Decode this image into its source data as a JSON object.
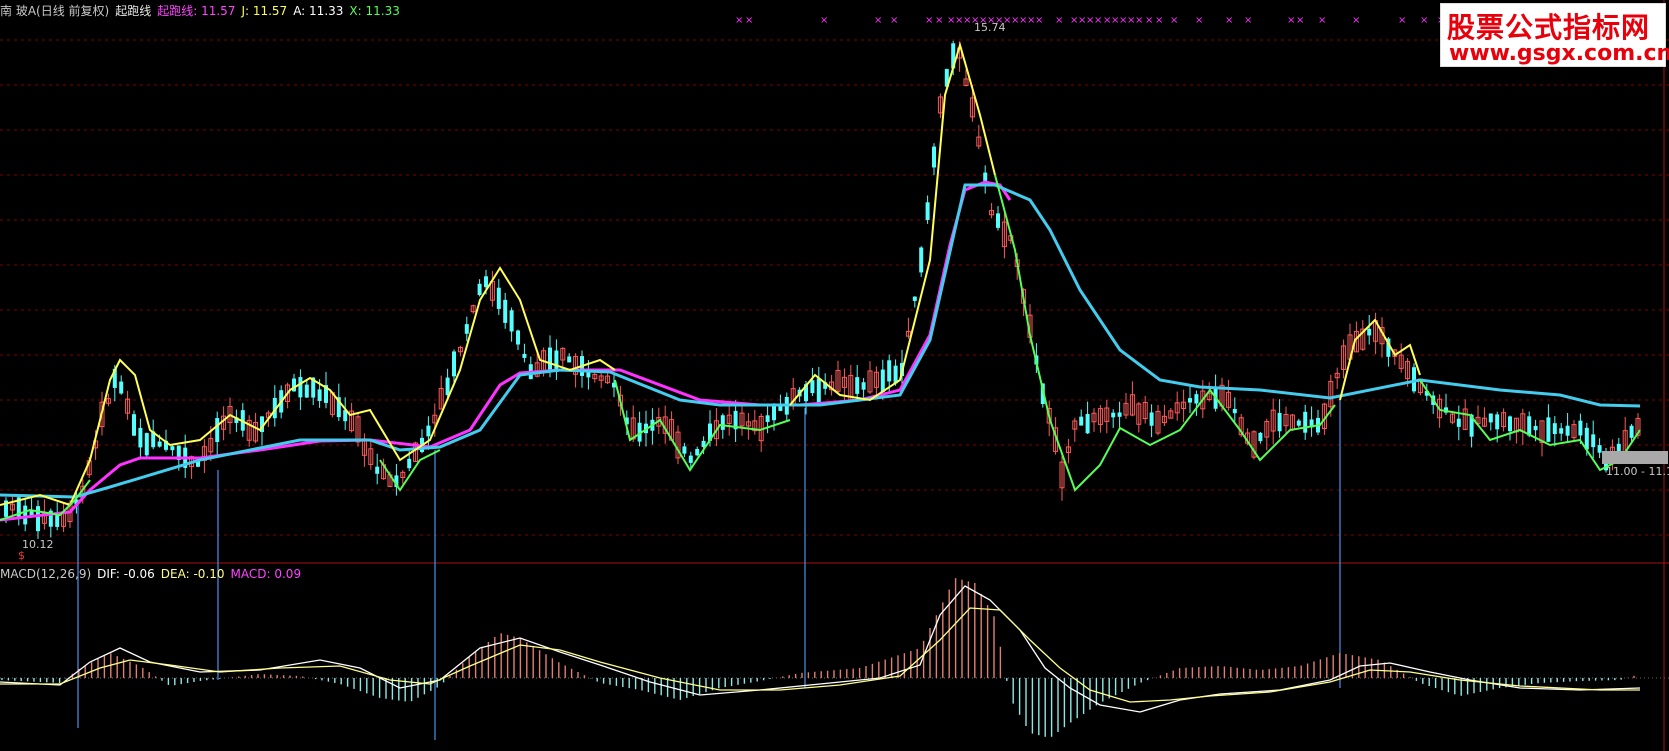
{
  "header": {
    "title": "南 玻A(日线 前复权)",
    "indicator_name": "起跑线",
    "indicator_value": "起跑线: 11.57",
    "j_value": "J: 11.57",
    "a_value": "A: 11.33",
    "x_value": "X: 11.33"
  },
  "macd_header": {
    "name": "MACD(12,26,9)",
    "dif": "DIF: -0.06",
    "dea": "DEA: -0.10",
    "macd": "MACD: 0.09"
  },
  "logo": {
    "line1": "股票公式指标网",
    "line2": "www.gsgx.com.cn"
  },
  "labels": {
    "high": "15.74",
    "low": "10.12",
    "range": "11.00 - 11.1",
    "low_marker": "$"
  },
  "colors": {
    "background": "#000000",
    "candle_up": "#ff5a5a",
    "candle_down": "#54ffff",
    "yellow_line": "#ffff55",
    "green_line": "#55ff55",
    "magenta_line": "#ff33ff",
    "cyan_line": "#44ccee",
    "marker": "#ff33ff",
    "signal_line": "#4488dd",
    "grid": "#800000"
  },
  "chart_data": {
    "type": "line",
    "panels": [
      "price",
      "macd"
    ],
    "price_range_visible": [
      10.12,
      15.74
    ],
    "series": [
      {
        "name": "起跑线",
        "last": 11.57
      },
      {
        "name": "J",
        "last": 11.57
      },
      {
        "name": "A",
        "last": 11.33
      },
      {
        "name": "X",
        "last": 11.33
      }
    ],
    "macd": {
      "params": "12,26,9",
      "dif": -0.06,
      "dea": -0.1,
      "macd": 0.09
    }
  }
}
